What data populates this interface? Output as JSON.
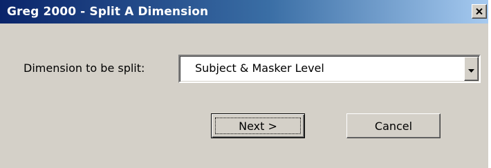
{
  "window": {
    "title": "Greg 2000 - Split A Dimension"
  },
  "form": {
    "dimension_label": "Dimension to be split:",
    "dimension_selected": "Subject & Masker Level"
  },
  "buttons": {
    "next_label": "Next >",
    "cancel_label": "Cancel"
  },
  "icons": {
    "close": "close-icon",
    "dropdown": "chevron-down-icon"
  },
  "colors": {
    "titlebar_start": "#0a246a",
    "titlebar_end": "#a6caf0",
    "dialog_face": "#d4d0c8"
  }
}
